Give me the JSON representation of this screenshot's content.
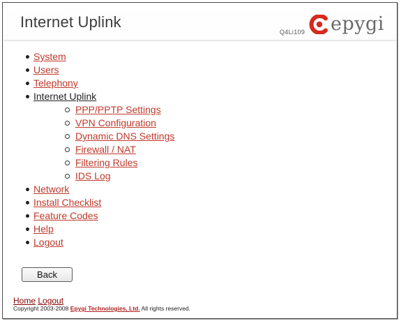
{
  "header": {
    "title": "Internet Uplink",
    "model": "Q4Li109",
    "logo_text": "epygi"
  },
  "menu": {
    "items": [
      {
        "label": "System",
        "level": 1,
        "current": false
      },
      {
        "label": "Users",
        "level": 1,
        "current": false
      },
      {
        "label": "Telephony",
        "level": 1,
        "current": false
      },
      {
        "label": "Internet Uplink",
        "level": 1,
        "current": true
      },
      {
        "label": "PPP/PPTP Settings",
        "level": 2,
        "current": false
      },
      {
        "label": "VPN Configuration",
        "level": 2,
        "current": false
      },
      {
        "label": "Dynamic DNS Settings",
        "level": 2,
        "current": false
      },
      {
        "label": "Firewall / NAT",
        "level": 2,
        "current": false
      },
      {
        "label": "Filtering Rules",
        "level": 2,
        "current": false
      },
      {
        "label": "IDS Log",
        "level": 2,
        "current": false
      },
      {
        "label": "Network",
        "level": 1,
        "current": false
      },
      {
        "label": "Install Checklist",
        "level": 1,
        "current": false
      },
      {
        "label": "Feature Codes",
        "level": 1,
        "current": false
      },
      {
        "label": "Help",
        "level": 1,
        "current": false
      },
      {
        "label": "Logout",
        "level": 1,
        "current": false
      }
    ]
  },
  "actions": {
    "back_label": "Back"
  },
  "footer": {
    "home_label": "Home",
    "logout_label": "Logout",
    "copyright_prefix": "Copyright 2003-2008",
    "company_label": "Epygi Technologies, Ltd.",
    "copyright_suffix": "All rights reserved."
  },
  "colors": {
    "link": "#c0392b",
    "logo_red": "#d62a1e",
    "logo_gray": "#6a6a6a"
  }
}
